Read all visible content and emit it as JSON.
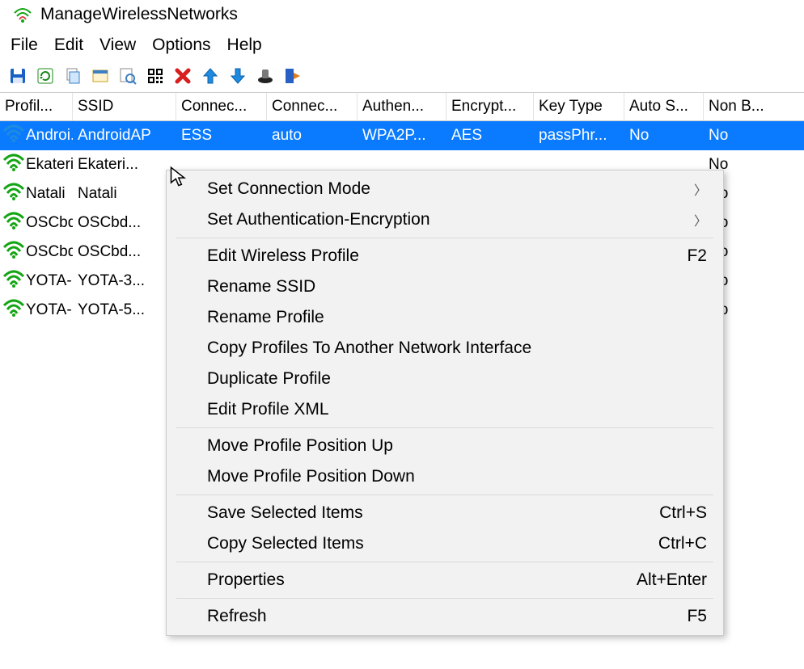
{
  "window": {
    "title": "ManageWirelessNetworks"
  },
  "menubar": [
    "File",
    "Edit",
    "View",
    "Options",
    "Help"
  ],
  "columns": {
    "profile": "Profil...",
    "ssid": "SSID",
    "connect": "Connec...",
    "connmode": "Connec...",
    "auth": "Authen...",
    "encrypt": "Encrypt...",
    "keytype": "Key Type",
    "autos": "Auto S...",
    "nonb": "Non B..."
  },
  "rows": [
    {
      "profile": "Androi...",
      "ssid": "AndroidAP",
      "connect": "ESS",
      "connmode": "auto",
      "auth": "WPA2P...",
      "encrypt": "AES",
      "keytype": "passPhr...",
      "autos": "No",
      "nonb": "No",
      "selected": true,
      "icon": "blue"
    },
    {
      "profile": "Ekateri...",
      "ssid": "Ekateri...",
      "nonb": "No"
    },
    {
      "profile": "Natali",
      "ssid": "Natali",
      "nonb": "No"
    },
    {
      "profile": "OSCbdv",
      "ssid": "OSCbd...",
      "nonb": "No"
    },
    {
      "profile": "OSCbd...",
      "ssid": "OSCbd...",
      "nonb": "No"
    },
    {
      "profile": "YOTA-...",
      "ssid": "YOTA-3...",
      "nonb": "No"
    },
    {
      "profile": "YOTA-...",
      "ssid": "YOTA-5...",
      "nonb": "No"
    }
  ],
  "contextMenu": [
    {
      "label": "Set Connection Mode",
      "arrow": true
    },
    {
      "label": "Set Authentication-Encryption",
      "arrow": true
    },
    {
      "sep": true
    },
    {
      "label": "Edit Wireless Profile",
      "shortcut": "F2"
    },
    {
      "label": "Rename SSID"
    },
    {
      "label": "Rename Profile"
    },
    {
      "label": "Copy Profiles To Another Network Interface"
    },
    {
      "label": "Duplicate Profile"
    },
    {
      "label": "Edit Profile XML"
    },
    {
      "sep": true
    },
    {
      "label": "Move Profile Position Up"
    },
    {
      "label": "Move Profile Position Down"
    },
    {
      "sep": true
    },
    {
      "label": "Save Selected Items",
      "shortcut": "Ctrl+S"
    },
    {
      "label": "Copy Selected Items",
      "shortcut": "Ctrl+C"
    },
    {
      "sep": true
    },
    {
      "label": "Properties",
      "shortcut": "Alt+Enter"
    },
    {
      "sep": true
    },
    {
      "label": "Refresh",
      "shortcut": "F5"
    }
  ]
}
